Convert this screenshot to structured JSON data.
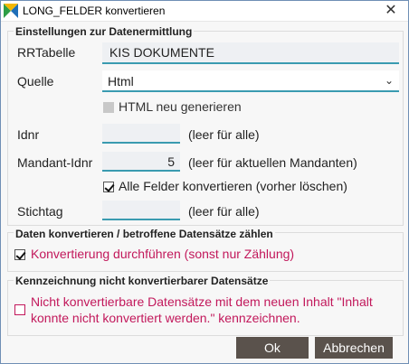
{
  "window": {
    "title": "LONG_FELDER konvertieren",
    "close_glyph": "✕"
  },
  "settings": {
    "group_title": "Einstellungen zur Datenermittlung",
    "rrtabelle_label": "RRTabelle",
    "rrtabelle_value": "KIS  DOKUMENTE",
    "quelle_label": "Quelle",
    "quelle_value": "Html",
    "html_neu_label": "HTML neu generieren",
    "html_neu_checked": false,
    "idnr_label": "Idnr",
    "idnr_value": "",
    "idnr_hint": "(leer für alle)",
    "mandant_label": "Mandant-Idnr",
    "mandant_value": "5",
    "mandant_hint": "(leer für aktuellen Mandanten)",
    "alle_felder_label": "Alle Felder konvertieren (vorher löschen)",
    "alle_felder_checked": true,
    "stichtag_label": "Stichtag",
    "stichtag_value": "",
    "stichtag_hint": "(leer für alle)"
  },
  "convert": {
    "group_title": "Daten konvertieren / betroffene Datensätze zählen",
    "label": "Konvertierung durchführen (sonst nur Zählung)",
    "checked": true
  },
  "mark": {
    "group_title": "Kennzeichnung nicht konvertierbarer Datensätze",
    "label_line1": "Nicht konvertierbare Datensätze mit dem neuen Inhalt \"Inhalt",
    "label_line2": "konnte nicht konvertiert werden.\" kennzeichnen.",
    "checked": false
  },
  "buttons": {
    "ok": "Ok",
    "cancel": "Abbrechen"
  },
  "colors": {
    "accent": "#3a9bb0",
    "pink_text": "#c2185b",
    "button_bg": "#5a524c"
  }
}
